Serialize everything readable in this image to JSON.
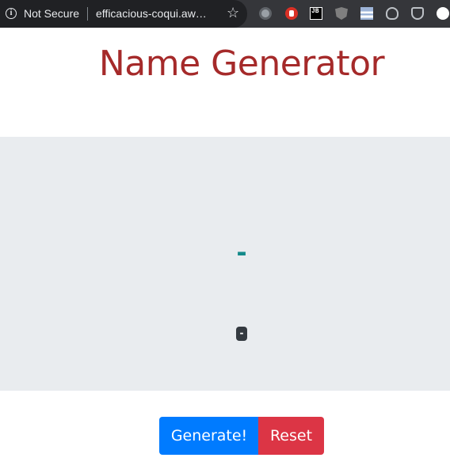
{
  "browser": {
    "security_label": "Not Secure",
    "url": "efficacious-coqui.aw…",
    "extensions": [
      "ext-circle-icon",
      "adblock-icon",
      "jetbrains-icon",
      "ublock-icon",
      "flag-icon",
      "lightbulb-icon",
      "pocket-icon",
      "profile-icon"
    ]
  },
  "page": {
    "title": "Name Generator",
    "generated_name": "-",
    "gender_badge": "-"
  },
  "buttons": {
    "generate": "Generate!",
    "reset": "Reset"
  },
  "colors": {
    "title": "#a52a2a",
    "panel_bg": "#e9ecef",
    "name_text": "#138a8a",
    "generate_bg": "#007bff",
    "reset_bg": "#dc3545"
  }
}
